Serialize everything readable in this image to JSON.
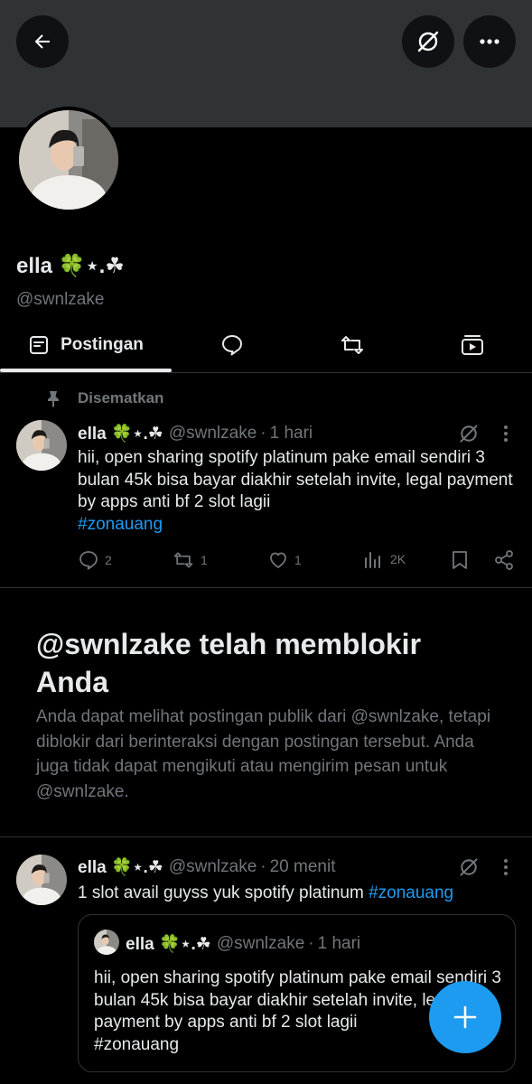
{
  "profile": {
    "display_name": "ella 🍀⋆.☘︎",
    "handle": "@swnlzake"
  },
  "tabs": [
    {
      "label": "Postingan",
      "icon": "posts-icon",
      "active": true
    },
    {
      "label": "",
      "icon": "replies-icon"
    },
    {
      "label": "",
      "icon": "repost-icon"
    },
    {
      "label": "",
      "icon": "media-icon"
    }
  ],
  "pinned_label": "Disematkan",
  "pinned_post": {
    "name": "ella 🍀⋆.☘︎",
    "handle": "@swnlzake",
    "dot": "·",
    "time": "1 hari",
    "text": "hii, open sharing spotify platinum pake email sendiri 3 bulan 45k bisa bayar diakhir setelah invite, legal payment by apps anti bf 2 slot lagii",
    "hashtag": "#zonauang",
    "replies": "2",
    "reposts": "1",
    "likes": "1",
    "views": "2K"
  },
  "blocked": {
    "title": "@swnlzake telah memblokir Anda",
    "description": "Anda dapat melihat postingan publik dari @swnlzake, tetapi diblokir dari berinteraksi dengan postingan tersebut. Anda juga tidak dapat mengikuti atau mengirim pesan untuk @swnlzake."
  },
  "post2": {
    "name": "ella 🍀⋆.☘︎",
    "handle": "@swnlzake",
    "dot": "·",
    "time": "20 menit",
    "text": "1 slot avail guyss yuk spotify platinum",
    "hashtag": "#zonauang"
  },
  "quote": {
    "name": "ella 🍀⋆.☘︎",
    "handle": "@swnlzake",
    "dot": "·",
    "time": "1 hari",
    "text": "hii, open sharing spotify platinum pake email sendiri 3 bulan 45k bisa bayar diakhir setelah invite, legal payment by apps anti bf 2 slot lagii",
    "hashtag": "#zonauang"
  },
  "colors": {
    "background": "#000000",
    "banner": "#2f3336",
    "accent": "#1d9bf0",
    "muted": "#71767b",
    "text": "#e7e9ea"
  }
}
